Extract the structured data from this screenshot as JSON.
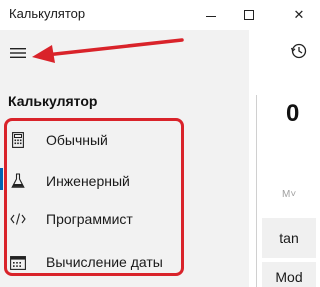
{
  "window": {
    "title": "Калькулятор",
    "minimize_label": "—",
    "close_label": "✕"
  },
  "menu": {
    "header": "Калькулятор",
    "items": [
      {
        "label": "Обычный",
        "icon": "calculator-icon"
      },
      {
        "label": "Инженерный",
        "icon": "flask-icon"
      },
      {
        "label": "Программист",
        "icon": "code-icon"
      },
      {
        "label": "Вычисление даты",
        "icon": "calendar-icon"
      }
    ],
    "selected_index": 1
  },
  "calculator": {
    "display_value": "0",
    "memory_label": "M˅",
    "keys": [
      "tan",
      "Mod"
    ]
  },
  "annotation": {
    "color": "#d9232a"
  }
}
